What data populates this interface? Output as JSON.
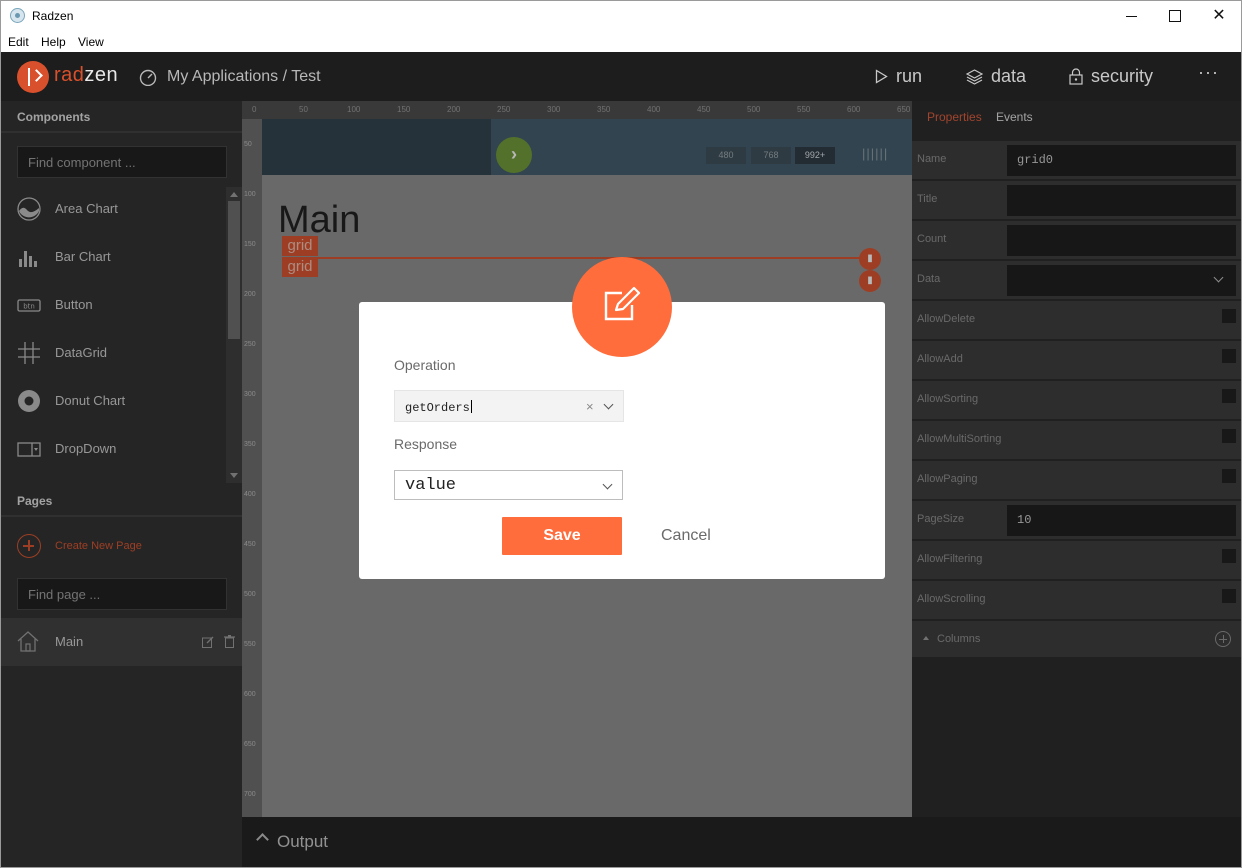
{
  "window": {
    "title": "Radzen"
  },
  "menu": [
    "Edit",
    "Help",
    "View"
  ],
  "header": {
    "logo_left": "rad",
    "logo_right": "zen",
    "breadcrumb": "My Applications / Test",
    "actions": {
      "run": "run",
      "data": "data",
      "security": "security",
      "more": "···"
    }
  },
  "sidebar": {
    "components_title": "Components",
    "find_component_placeholder": "Find component ...",
    "components": [
      {
        "label": "Area Chart",
        "icon": "area-chart-icon"
      },
      {
        "label": "Bar Chart",
        "icon": "bar-chart-icon"
      },
      {
        "label": "Button",
        "icon": "button-icon"
      },
      {
        "label": "DataGrid",
        "icon": "datagrid-icon"
      },
      {
        "label": "Donut Chart",
        "icon": "donut-chart-icon"
      },
      {
        "label": "DropDown",
        "icon": "dropdown-icon"
      }
    ],
    "pages_title": "Pages",
    "create_page": "Create New Page",
    "find_page_placeholder": "Find page ...",
    "pages": [
      {
        "label": "Main"
      }
    ]
  },
  "canvas": {
    "ruler_top": [
      "0",
      "50",
      "100",
      "150",
      "200",
      "250",
      "300",
      "350",
      "400",
      "450",
      "500",
      "550",
      "600",
      "650"
    ],
    "ruler_left": [
      "50",
      "100",
      "150",
      "200",
      "250",
      "300",
      "350",
      "400",
      "450",
      "500",
      "550",
      "600",
      "650",
      "700"
    ],
    "devices": [
      "480",
      "768",
      "992+"
    ],
    "device_meter": "||||||",
    "page_heading": "Main",
    "grid_tags": [
      "grid",
      "grid"
    ]
  },
  "output": {
    "label": "Output"
  },
  "properties": {
    "tabs": [
      "Properties",
      "Events"
    ],
    "rows": [
      {
        "label": "Name",
        "value": "grid0"
      },
      {
        "label": "Title",
        "value": ""
      },
      {
        "label": "Count",
        "value": ""
      },
      {
        "label": "Data",
        "value": ""
      },
      {
        "label": "AllowDelete"
      },
      {
        "label": "AllowAdd"
      },
      {
        "label": "AllowSorting"
      },
      {
        "label": "AllowMultiSorting"
      },
      {
        "label": "AllowPaging"
      },
      {
        "label": "PageSize",
        "value": "10"
      },
      {
        "label": "AllowFiltering"
      },
      {
        "label": "AllowScrolling"
      }
    ],
    "columns_label": "Columns"
  },
  "dialog": {
    "operation_label": "Operation",
    "operation_value": "getOrders",
    "clear_symbol": "×",
    "response_label": "Response",
    "response_value": "value",
    "save_label": "Save",
    "cancel_label": "Cancel"
  },
  "colors": {
    "accent": "#ff6d3c",
    "brand": "#d9512c",
    "go": "#6f9a35"
  }
}
